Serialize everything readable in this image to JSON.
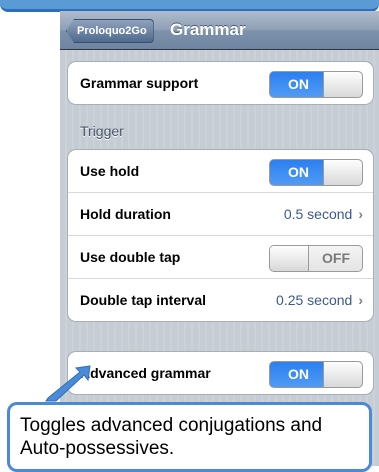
{
  "navbar": {
    "back_label": "Proloquo2Go",
    "title": "Grammar"
  },
  "groups": {
    "main": {
      "row": {
        "label": "Grammar support",
        "toggle": "ON"
      }
    },
    "trigger": {
      "header": "Trigger",
      "rows": [
        {
          "label": "Use hold",
          "toggle": "ON"
        },
        {
          "label": "Hold duration",
          "value": "0.5 second"
        },
        {
          "label": "Use double tap",
          "toggle": "OFF"
        },
        {
          "label": "Double tap interval",
          "value": "0.25 second"
        }
      ]
    },
    "advanced": {
      "row": {
        "label": "Advanced grammar",
        "toggle": "ON"
      }
    }
  },
  "chevron": "›",
  "callout": {
    "text": "Toggles advanced conjugations and Auto-possessives."
  },
  "colors": {
    "callout_border": "#4a8ad8",
    "toggle_on": "#2c7ff0",
    "navbar": "#7e92ab"
  }
}
